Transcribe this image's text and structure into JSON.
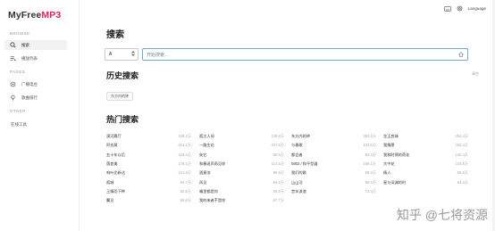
{
  "app": {
    "logo_left": "MyFree",
    "logo_right": "MP3"
  },
  "sidebar": {
    "sections": [
      {
        "label": "BROWSE"
      },
      {
        "label": "PAGES"
      },
      {
        "label": "OTHER"
      }
    ],
    "items": [
      {
        "label": "搜索",
        "icon": "search-icon",
        "active": true
      },
      {
        "label": "播放列表",
        "icon": "playlist-icon",
        "active": false
      },
      {
        "label": "广播电台",
        "icon": "radio-icon",
        "active": false
      },
      {
        "label": "歌曲排行",
        "icon": "podcast-icon",
        "active": false
      },
      {
        "label": "在线工具",
        "icon": "",
        "active": false
      }
    ]
  },
  "topbar": {
    "language_label": "Language",
    "icons": [
      "keyboard-icon",
      "settings-icon"
    ]
  },
  "main": {
    "title": "搜索",
    "search": {
      "type_value": "A",
      "placeholder": "开始搜索..."
    },
    "history": {
      "title": "历史搜索",
      "clear_label": "清空",
      "tags": [
        "东方内的钟"
      ]
    },
    "hot": {
      "title": "热门搜索",
      "rows": [
        [
          {
            "name": "漠河舞厅",
            "count": "159.2万"
          },
          {
            "name": "孤注人间",
            "count": "136.6万"
          },
          {
            "name": "东方内的钟",
            "count": "252.6万"
          },
          {
            "name": "金玉良缘",
            "count": "254.4万"
          }
        ],
        [
          {
            "name": "阿衣莫",
            "count": "221.1万"
          },
          {
            "name": "一路生花",
            "count": "237.5万"
          },
          {
            "name": "与春歌",
            "count": "103.6万"
          },
          {
            "name": "我情愿",
            "count": "194.4万"
          }
        ],
        [
          {
            "name": "五十年以后",
            "count": "184.4万"
          },
          {
            "name": "失忆",
            "count": "90.9万"
          },
          {
            "name": "都会者",
            "count": "94.4万"
          },
          {
            "name": "我和时锦的荷花",
            "count": "120.4万"
          }
        ],
        [
          {
            "name": "落差美",
            "count": "176.4万"
          },
          {
            "name": "和春说声再见你",
            "count": "112.5万"
          },
          {
            "name": "0802 / 和平型器",
            "count": "169.1万"
          },
          {
            "name": "大中花",
            "count": "103.5万"
          }
        ],
        [
          {
            "name": "响叶比新达",
            "count": "101.9万"
          },
          {
            "name": "酒意浓",
            "count": "99.9万"
          },
          {
            "name": "我们的歌",
            "count": "98.9万"
          },
          {
            "name": "情人",
            "count": "98.6万"
          }
        ],
        [
          {
            "name": "孤城",
            "count": "94.7万"
          },
          {
            "name": "再见",
            "count": "94.6万"
          },
          {
            "name": "山山河",
            "count": "89.9万"
          },
          {
            "name": "星与深渊的时",
            "count": "84.4万"
          }
        ],
        [
          {
            "name": "王情而下种",
            "count": "82.6万"
          },
          {
            "name": "嘴里都是你",
            "count": "80.9万"
          },
          {
            "name": "昔年流浪",
            "count": "72.3万"
          },
          {
            "name": "",
            "count": ""
          }
        ],
        [
          {
            "name": "翼见",
            "count": "66.8万"
          },
          {
            "name": "我的来者不是你",
            "count": "67.7万"
          },
          {
            "name": "",
            "count": ""
          },
          {
            "name": "",
            "count": ""
          }
        ]
      ]
    }
  },
  "watermark": {
    "text": "知乎 @七将资源"
  },
  "colors": {
    "accent": "#e2215d",
    "focus_border": "#6ea8d7"
  }
}
